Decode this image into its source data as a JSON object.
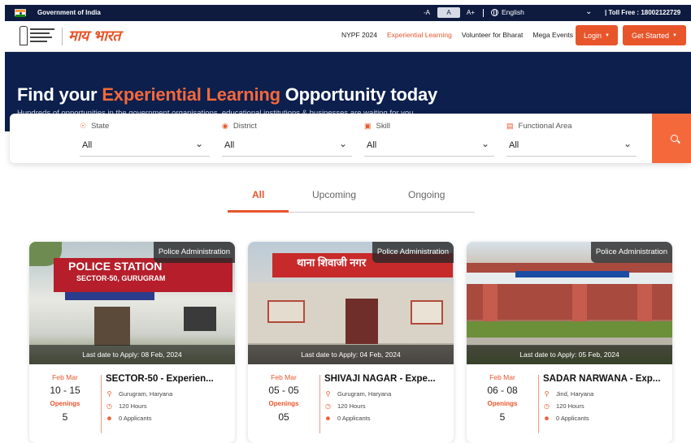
{
  "govbar": {
    "gov_text": "Government of India",
    "font_small": "-A",
    "font_normal": "A",
    "font_large": "A+",
    "language": "English",
    "toll_free": "| Toll Free : 18002122729"
  },
  "nav": {
    "logo_text": "माय भारत",
    "links": [
      "NYPF 2024",
      "Experiential Learning",
      "Volunteer for Bharat",
      "Mega Events"
    ],
    "login_label": "Login",
    "get_started_label": "Get Started",
    "accent": "#e8552b"
  },
  "hero": {
    "title_pre": "Find your ",
    "title_highlight": "Experiential Learning",
    "title_post": " Opportunity today",
    "subtitle": "Hundreds of opportunities in the government organisations, educational institutions & businesses are waiting for you"
  },
  "search": {
    "fields": [
      {
        "label": "State",
        "value": "All",
        "icon": "location-icon"
      },
      {
        "label": "District",
        "value": "All",
        "icon": "eye-icon"
      },
      {
        "label": "Skill",
        "value": "All",
        "icon": "skill-icon"
      },
      {
        "label": "Functional Area",
        "value": "All",
        "icon": "calendar-icon"
      }
    ]
  },
  "tabs": [
    {
      "label": "All",
      "active": true
    },
    {
      "label": "Upcoming",
      "active": false
    },
    {
      "label": "Ongoing",
      "active": false
    }
  ],
  "cards": [
    {
      "tag": "Police Administration",
      "deadline": "Last date to Apply: 08 Feb, 2024",
      "months": "Feb Mar",
      "days": "10 - 15",
      "openings_label": "Openings",
      "openings": "5",
      "title": "SECTOR-50 - Experien...",
      "location": "Gurugram, Haryana",
      "hours": "120 Hours",
      "applicants": "0 Applicants",
      "photo_text": "POLICE STATION",
      "photo_sub": "SECTOR-50, GURUGRAM"
    },
    {
      "tag": "Police Administration",
      "deadline": "Last date to Apply: 04 Feb, 2024",
      "months": "Feb Mar",
      "days": "05 - 05",
      "openings_label": "Openings",
      "openings": "05",
      "title": "SHIVAJI NAGAR - Expe...",
      "location": "Gurugram, Haryana",
      "hours": "120 Hours",
      "applicants": "0 Applicants",
      "photo_text": "थाना शिवाजी नगर"
    },
    {
      "tag": "Police Administration",
      "deadline": "Last date to Apply: 05 Feb, 2024",
      "months": "Feb Mar",
      "days": "06 - 08",
      "openings_label": "Openings",
      "openings": "5",
      "title": "SADAR NARWANA - Exp...",
      "location": "Jind, Haryana",
      "hours": "120 Hours",
      "applicants": "0 Applicants"
    }
  ]
}
